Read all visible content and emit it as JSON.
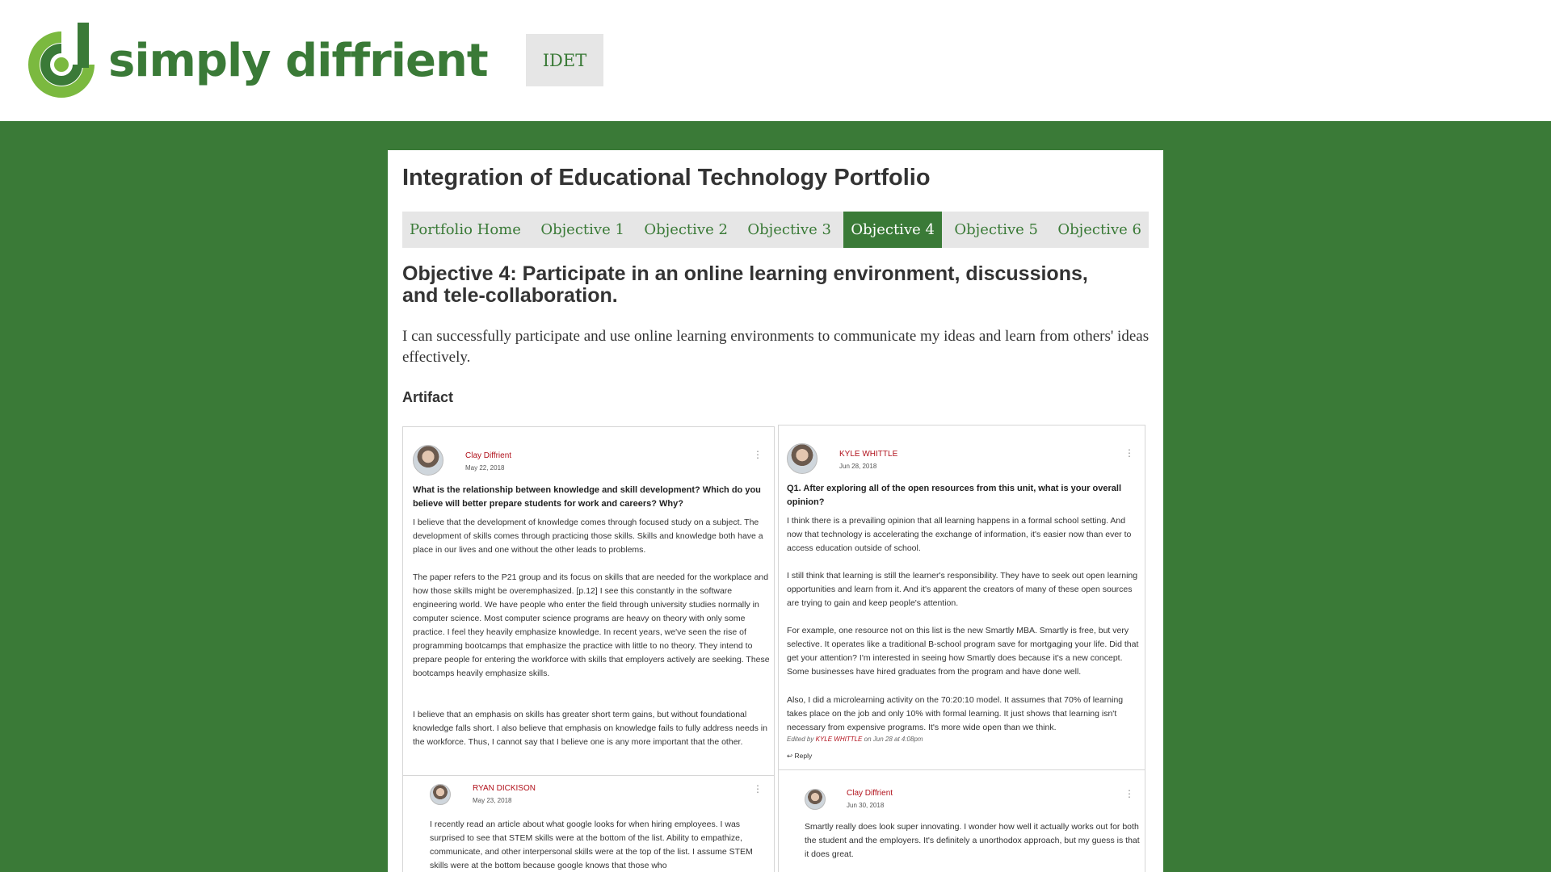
{
  "header": {
    "logo_text": "simply diffrient",
    "button_label": "IDET",
    "brand_color": "#3a7a37"
  },
  "page": {
    "title": "Integration of Educational Technology Portfolio",
    "nav": [
      {
        "label": "Portfolio Home",
        "active": false
      },
      {
        "label": "Objective 1",
        "active": false
      },
      {
        "label": "Objective 2",
        "active": false
      },
      {
        "label": "Objective 3",
        "active": false
      },
      {
        "label": "Objective 4",
        "active": true
      },
      {
        "label": "Objective 5",
        "active": false
      },
      {
        "label": "Objective 6",
        "active": false
      }
    ],
    "objective_title": "Objective 4: Participate in an online learning environment, discussions, and tele-collaboration.",
    "intro": "I can successfully participate and use online learning environments to communicate my ideas and learn from others' ideas effectively.",
    "artifact_heading": "Artifact"
  },
  "artifact": {
    "left": {
      "post": {
        "author": "Clay Diffrient",
        "date": "May 22, 2018",
        "menu": "⋮",
        "question": "What is the relationship between knowledge and skill development? Which do you believe will better prepare students for work and careers? Why?",
        "paragraphs": [
          "I believe that the development of knowledge comes through focused study on a subject.  The development of skills comes through practicing those skills.  Skills and knowledge both have a place in our lives and one without the other leads to problems.",
          "The paper refers to the P21 group and its focus on skills that are needed for the workplace and how those skills might be overemphasized. [p.12] I see this constantly in the software engineering world.  We have people who enter the field through university studies normally in computer science.  Most computer science programs are heavy on theory with only some practice.  I feel they heavily emphasize knowledge. In recent years, we've seen the rise of programming bootcamps that emphasize the practice with little to no theory.  They intend to prepare people for entering the workforce with skills that employers actively are seeking.  These bootcamps heavily emphasize skills.",
          "I believe that an emphasis on skills has greater short term gains, but without foundational knowledge falls short.  I also believe that emphasis on knowledge fails to fully address needs in the workforce. Thus, I cannot say that I believe one is any more important that the other."
        ]
      },
      "reply": {
        "author": "RYAN DICKISON",
        "date": "May 23, 2018",
        "menu": "⋮",
        "text": "I recently read an article about what google looks for when hiring employees. I was surprised to see that STEM skills were at the bottom of the list. Ability to empathize, communicate, and other interpersonal skills were at the top of the list. I assume STEM skills were at the bottom because google knows that those who"
      }
    },
    "right": {
      "post": {
        "author": "KYLE WHITTLE",
        "date": "Jun 28, 2018",
        "menu": "⋮",
        "question": "Q1. After exploring all of the open resources from this unit, what is your overall opinion?",
        "paragraphs": [
          "I think there is a prevailing opinion that all learning happens in a formal school setting. And now that technology is accelerating the exchange of information, it's easier now than ever to access education outside of school.",
          "I still think that learning is still the learner's responsibility. They have to seek out open learning opportunities and learn from it. And it's apparent the creators of many of these open sources are trying to gain and keep people's attention.",
          "For example, one resource not on this list is the new Smartly MBA. Smartly is free, but very selective. It operates like a traditional B-school program save for mortgaging your life. Did that get your attention? I'm interested in seeing how Smartly does because it's a new concept. Some businesses have hired graduates from the program and have done well.",
          "Also, I did a microlearning activity on the 70:20:10 model. It assumes that 70% of learning takes place on the job and only 10% with formal learning. It just shows that learning isn't necessary from expensive programs. It's more wide open than we think."
        ],
        "edited_prefix": "Edited by",
        "edited_by": "KYLE WHITTLE",
        "edited_suffix": "on Jun 28 at 4:08pm",
        "reply_label": "↩ Reply"
      },
      "reply": {
        "author": "Clay Diffrient",
        "date": "Jun 30, 2018",
        "menu": "⋮",
        "text": "Smartly really does look super innovating.  I wonder how well it actually works out for both the student and the employers.  It's definitely a unorthodox approach, but my guess is that it does great."
      }
    }
  }
}
